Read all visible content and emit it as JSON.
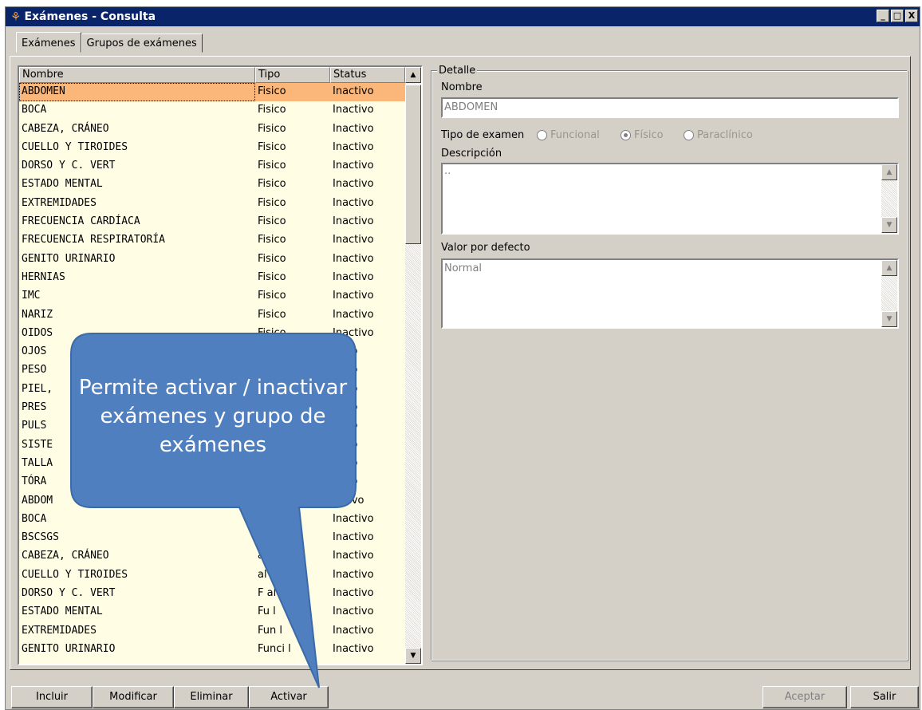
{
  "window": {
    "title": "Exámenes - Consulta",
    "controls": [
      "_",
      "□",
      "X"
    ]
  },
  "tabs": [
    {
      "label": "Exámenes"
    },
    {
      "label": "Grupos de exámenes"
    }
  ],
  "list": {
    "headers": {
      "name": "Nombre",
      "tipo": "Tipo",
      "status": "Status"
    },
    "rows": [
      {
        "name": "ABDOMEN",
        "tipo": "Fisico",
        "status": "Inactivo"
      },
      {
        "name": "BOCA",
        "tipo": "Fisico",
        "status": "Inactivo"
      },
      {
        "name": "CABEZA, CRÁNEO",
        "tipo": "Fisico",
        "status": "Inactivo"
      },
      {
        "name": "CUELLO Y TIROIDES",
        "tipo": "Fisico",
        "status": "Inactivo"
      },
      {
        "name": "DORSO Y C. VERT",
        "tipo": "Fisico",
        "status": "Inactivo"
      },
      {
        "name": "ESTADO MENTAL",
        "tipo": "Fisico",
        "status": "Inactivo"
      },
      {
        "name": "EXTREMIDADES",
        "tipo": "Fisico",
        "status": "Inactivo"
      },
      {
        "name": "FRECUENCIA CARDÍACA",
        "tipo": "Fisico",
        "status": "Inactivo"
      },
      {
        "name": "FRECUENCIA RESPIRATORÍA",
        "tipo": "Fisico",
        "status": "Inactivo"
      },
      {
        "name": "GENITO URINARIO",
        "tipo": "Fisico",
        "status": "Inactivo"
      },
      {
        "name": "HERNIAS",
        "tipo": "Fisico",
        "status": "Inactivo"
      },
      {
        "name": "IMC",
        "tipo": "Fisico",
        "status": "Inactivo"
      },
      {
        "name": "NARIZ",
        "tipo": "Fisico",
        "status": "Inactivo"
      },
      {
        "name": "OIDOS",
        "tipo": "Fisico",
        "status": "Inactivo"
      },
      {
        "name": "OJOS",
        "tipo": "",
        "status": "ctivo"
      },
      {
        "name": "PESO",
        "tipo": "",
        "status": "ctivo"
      },
      {
        "name": "PIEL,",
        "tipo": "",
        "status": "ctivo"
      },
      {
        "name": "PRES",
        "tipo": "",
        "status": "ctivo"
      },
      {
        "name": "PULS",
        "tipo": "",
        "status": "ctivo"
      },
      {
        "name": "SISTE",
        "tipo": "",
        "status": "ctivo"
      },
      {
        "name": "TALLA",
        "tipo": "",
        "status": "ctivo"
      },
      {
        "name": "TÓRA",
        "tipo": "",
        "status": "ctivo"
      },
      {
        "name": "ABDOM",
        "tipo": "",
        "status": "activo"
      },
      {
        "name": "BOCA",
        "tipo": "al",
        "status": "Inactivo"
      },
      {
        "name": "BSCSGS",
        "tipo": "al",
        "status": "Inactivo"
      },
      {
        "name": "CABEZA, CRÁNEO",
        "tipo": "al",
        "status": "Inactivo"
      },
      {
        "name": "CUELLO Y TIROIDES",
        "tipo": "al",
        "status": "Inactivo"
      },
      {
        "name": "DORSO Y C. VERT",
        "tipo": "F      al",
        "status": "Inactivo"
      },
      {
        "name": "ESTADO MENTAL",
        "tipo": "Fu      l",
        "status": "Inactivo"
      },
      {
        "name": "EXTREMIDADES",
        "tipo": "Fun      l",
        "status": "Inactivo"
      },
      {
        "name": "GENITO URINARIO",
        "tipo": "Funci      l",
        "status": "Inactivo"
      }
    ],
    "selected_index": 0
  },
  "detail": {
    "legend": "Detalle",
    "nombre_label": "Nombre",
    "nombre_value": "ABDOMEN",
    "tipo_label": "Tipo de examen",
    "tipo_options": [
      {
        "label": "Funcional",
        "selected": false
      },
      {
        "label": "Físico",
        "selected": true
      },
      {
        "label": "Paraclínico",
        "selected": false
      }
    ],
    "descripcion_label": "Descripción",
    "descripcion_value": "..",
    "valor_label": "Valor por defecto",
    "valor_value": "Normal"
  },
  "buttons": {
    "incluir": "Incluir",
    "modificar": "Modificar",
    "eliminar": "Eliminar",
    "activar": "Activar",
    "aceptar": "Aceptar",
    "salir": "Salir"
  },
  "callout": {
    "text": "Permite activar / inactivar exámenes y grupo de exámenes",
    "color": "#4f7fbf"
  },
  "colors": {
    "selection": "#fbb77a",
    "list_bg": "#fffde4",
    "titlebar": "#0a246a"
  }
}
